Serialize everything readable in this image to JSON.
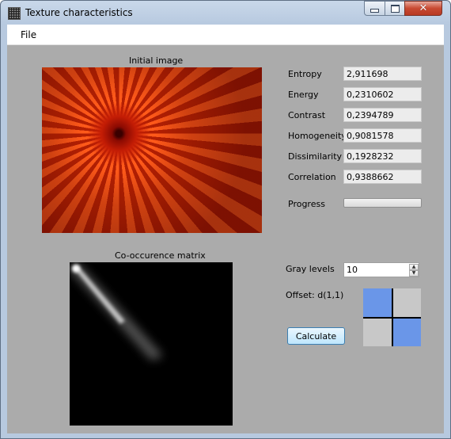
{
  "window": {
    "title": "Texture characteristics",
    "controls": {
      "minimize_icon": "minimize-icon",
      "maximize_icon": "maximize-icon",
      "close_icon": "close-icon",
      "close_glyph": "✕"
    }
  },
  "menu": {
    "file": "File"
  },
  "initial_image": {
    "caption": "Initial image"
  },
  "cooccurrence": {
    "caption": "Co-occurence matrix"
  },
  "stats": [
    {
      "label": "Entropy",
      "value": "2,911698"
    },
    {
      "label": "Energy",
      "value": "0,2310602"
    },
    {
      "label": "Contrast",
      "value": "0,2394789"
    },
    {
      "label": "Homogeneity",
      "value": "0,9081578"
    },
    {
      "label": "Dissimilarity",
      "value": "0,1928232"
    },
    {
      "label": "Correlation",
      "value": "0,9388662"
    }
  ],
  "progress": {
    "label": "Progress",
    "value": 0
  },
  "gray_levels": {
    "label": "Gray levels",
    "value": "10"
  },
  "offset": {
    "label": "Offset: d(1,1)",
    "cells": [
      "#6a96e8",
      "#c8c8c8",
      "#c8c8c8",
      "#6a96e8"
    ]
  },
  "calculate": {
    "label": "Calculate"
  },
  "colors": {
    "client_bg": "#ababab",
    "offset_active": "#6a96e8",
    "offset_inactive": "#c8c8c8"
  }
}
